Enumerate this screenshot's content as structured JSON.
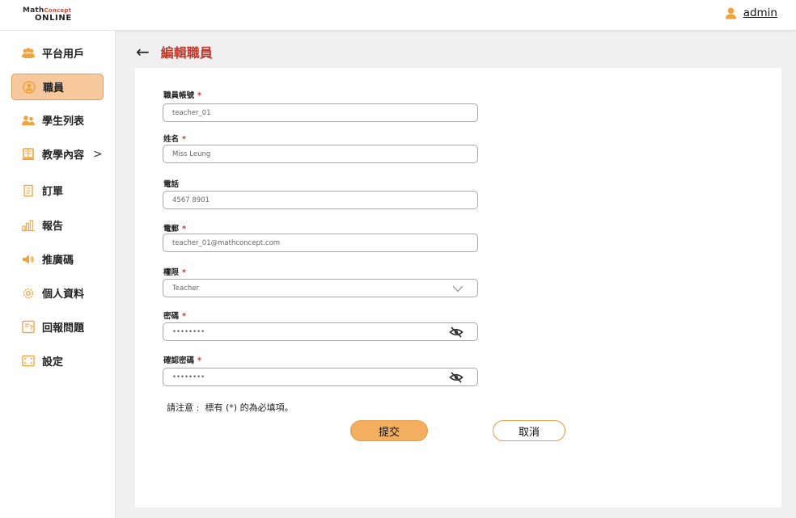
{
  "header": {
    "logo_line1_main": "Math",
    "logo_line1_accent": "Concept",
    "logo_line2": "ONLINE",
    "username": "admin",
    "user_icon": "person-icon",
    "accent_color": "#f0a33c"
  },
  "sidebar": {
    "items": [
      {
        "label": "平台用戶",
        "icon": "users-group-icon"
      },
      {
        "label": "職員",
        "icon": "staff-icon",
        "active": true
      },
      {
        "label": "學生列表",
        "icon": "students-icon"
      },
      {
        "label": "教學內容",
        "icon": "book-icon",
        "has_submenu": true,
        "submenu_glyph": ">"
      },
      {
        "label": "訂單",
        "icon": "receipt-icon"
      },
      {
        "label": "報告",
        "icon": "bar-chart-icon"
      },
      {
        "label": "推廣碼",
        "icon": "megaphone-icon"
      },
      {
        "label": "個人資料",
        "icon": "gear-icon"
      },
      {
        "label": "回報問題",
        "icon": "report-issue-icon"
      },
      {
        "label": "設定",
        "icon": "settings-frame-icon"
      }
    ],
    "active_bg": "#f6c89b"
  },
  "page": {
    "back_glyph": "←",
    "title": "編輯職員",
    "title_color": "#c0392b"
  },
  "form": {
    "fields": [
      {
        "label": "職員帳號",
        "required": true,
        "value": "teacher_01"
      },
      {
        "label": "姓名",
        "required": true,
        "value": "Miss Leung"
      },
      {
        "label": "電話",
        "required": false,
        "value": "4567 8901"
      },
      {
        "label": "電郵",
        "required": true,
        "value": "teacher_01@mathconcept.com"
      },
      {
        "label": "權限",
        "required": true,
        "value": "Teacher",
        "type": "select"
      },
      {
        "label": "密碼",
        "required": true,
        "value": "••••••••",
        "type": "password"
      },
      {
        "label": "確認密碼",
        "required": true,
        "value": "••••••••",
        "type": "password"
      }
    ],
    "required_mark": "*",
    "note": "請注意﹕ 標有 (*) 的為必填項。",
    "submit_label": "提交",
    "cancel_label": "取消",
    "button_color": "#f4ae5f"
  }
}
